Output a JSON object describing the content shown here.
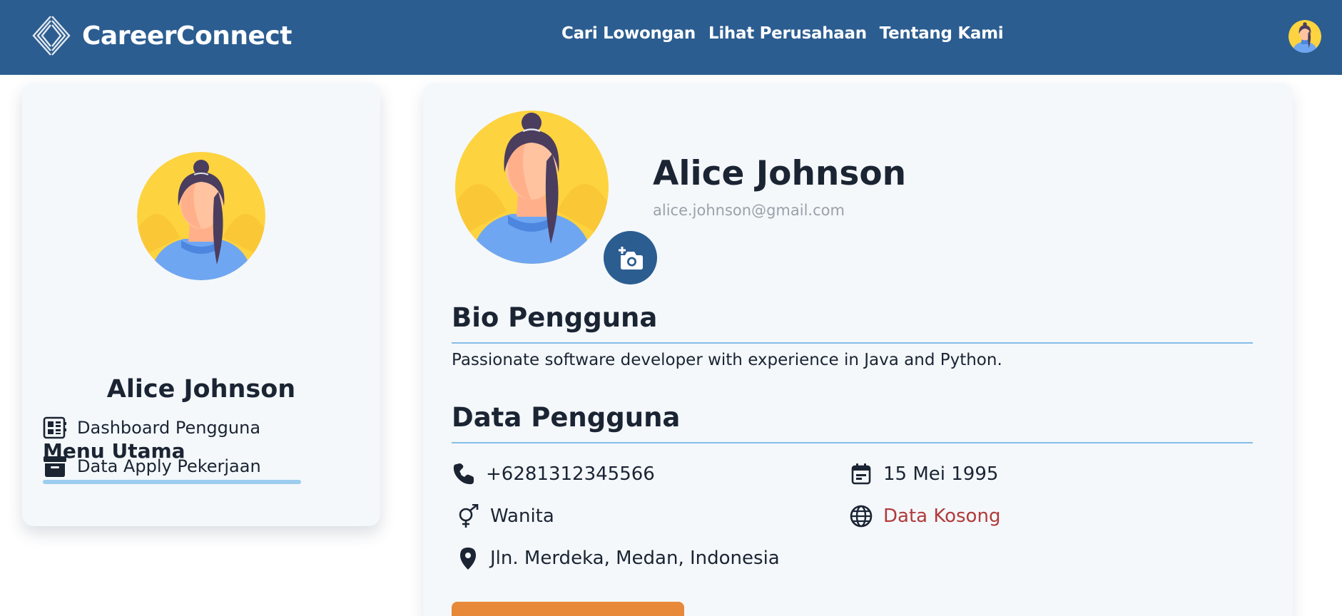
{
  "app": {
    "brand_name": "CareerConnect"
  },
  "navbar": {
    "links": [
      {
        "label": "Cari Lowongan"
      },
      {
        "label": "Lihat Perusahaan"
      },
      {
        "label": "Tentang Kami"
      }
    ],
    "avatar_icon": "user-avatar-icon"
  },
  "sidebar": {
    "user_name": "Alice Johnson",
    "menu_title": "Menu Utama",
    "menu_items": [
      {
        "label": "Dashboard Pengguna",
        "icon": "dashboard-icon"
      },
      {
        "label": "Data Apply Pekerjaan",
        "icon": "archive-box-icon"
      }
    ]
  },
  "profile": {
    "name": "Alice Johnson",
    "email": "alice.johnson@gmail.com",
    "camera_icon": "add-photo-camera-icon",
    "bio_title": "Bio Pengguna",
    "bio_text": "Passionate software developer with experience in Java and Python.",
    "data_title": "Data Pengguna",
    "data": {
      "phone": "+6281312345566",
      "birth_date": "15 Mei 1995",
      "gender": "Wanita",
      "website": "Data Kosong",
      "address": "Jln. Merdeka, Medan, Indonesia"
    }
  },
  "colors": {
    "primary": "#2b5d91",
    "card_bg": "#f4f8fb",
    "accent_rule": "#84bde6",
    "empty_text": "#b23a3a",
    "action_orange": "#e8893a",
    "avatar_bg": "#fdd33f"
  }
}
